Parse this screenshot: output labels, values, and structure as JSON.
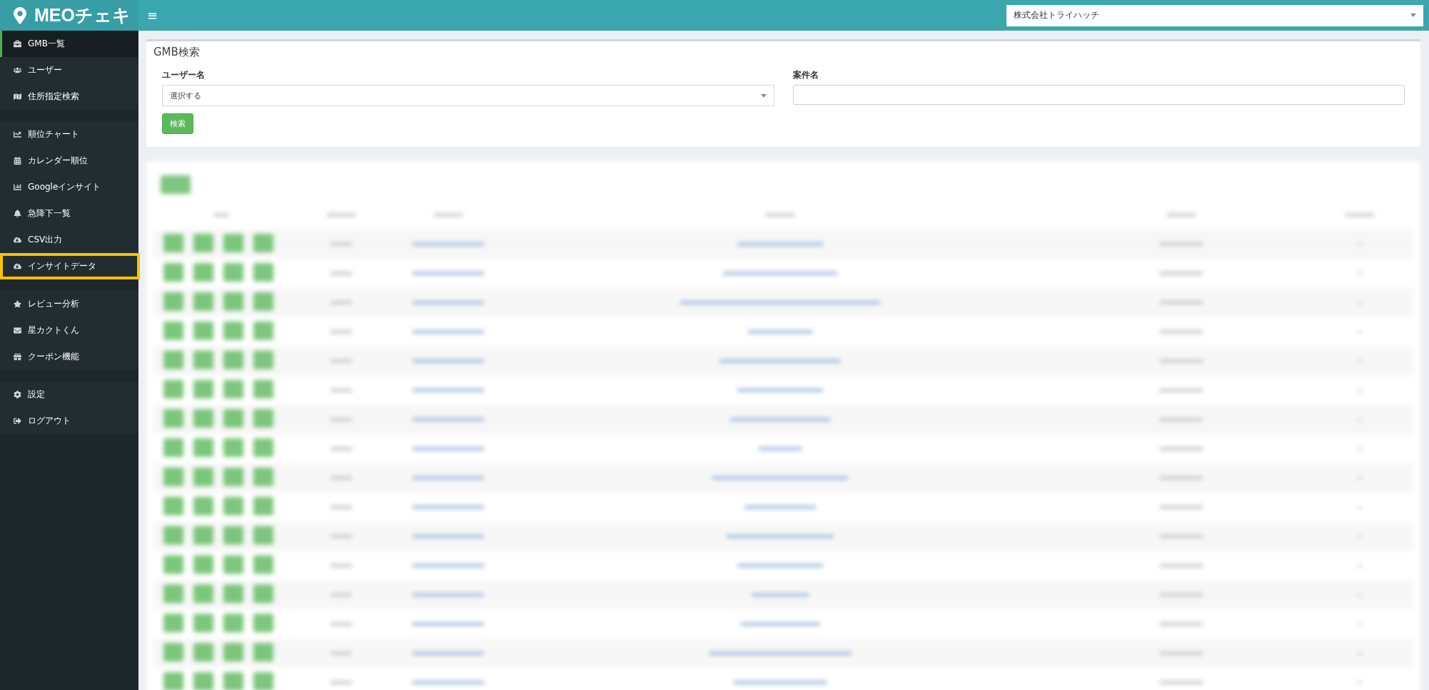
{
  "header": {
    "logo": "MEOチェキ",
    "menu_toggle": "≡",
    "company_select": {
      "value": "株式会社トライハッチ"
    }
  },
  "sidebar": {
    "groups": [
      {
        "items": [
          {
            "label": "GMB一覧",
            "selected": true,
            "highlighted": false
          },
          {
            "label": "ユーザー",
            "selected": false,
            "highlighted": false
          },
          {
            "label": "住所指定検索",
            "selected": false,
            "highlighted": false
          }
        ]
      },
      {
        "items": [
          {
            "label": "順位チャート",
            "selected": false,
            "highlighted": false
          },
          {
            "label": "カレンダー順位",
            "selected": false,
            "highlighted": false
          },
          {
            "label": "Googleインサイト",
            "selected": false,
            "highlighted": false
          },
          {
            "label": "急降下一覧",
            "selected": false,
            "highlighted": false
          },
          {
            "label": "CSV出力",
            "selected": false,
            "highlighted": false
          },
          {
            "label": "インサイトデータ",
            "selected": false,
            "highlighted": true
          }
        ]
      },
      {
        "items": [
          {
            "label": "レビュー分析",
            "selected": false,
            "highlighted": false
          },
          {
            "label": "星カクトくん",
            "selected": false,
            "highlighted": false
          },
          {
            "label": "クーポン機能",
            "selected": false,
            "highlighted": false
          }
        ]
      },
      {
        "items": [
          {
            "label": "設定",
            "selected": false,
            "highlighted": false
          },
          {
            "label": "ログアウト",
            "selected": false,
            "highlighted": false
          }
        ]
      }
    ]
  },
  "search_panel": {
    "title": "GMB検索",
    "fields": [
      {
        "kind": "select",
        "label": "ユーザー名",
        "value": "選択する"
      },
      {
        "kind": "text",
        "label": "案件名"
      }
    ],
    "button": "検索"
  },
  "results_panel": {
    "kind": "blurred"
  }
}
